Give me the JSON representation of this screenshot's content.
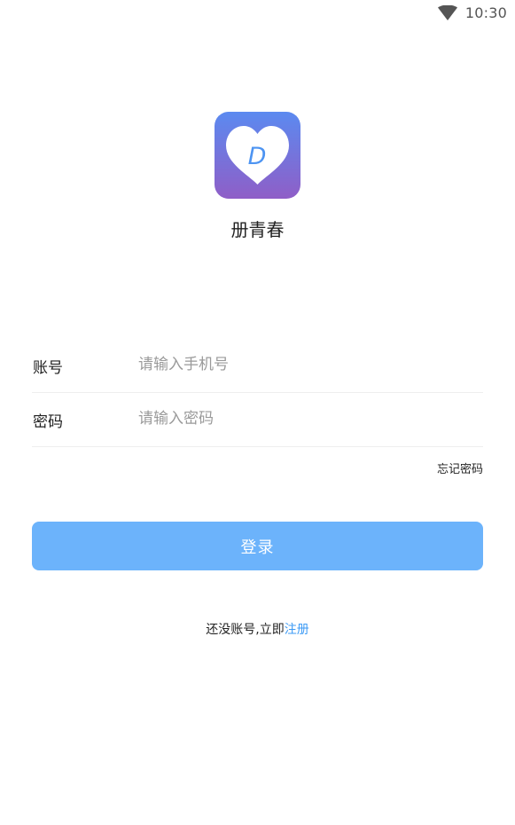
{
  "status_bar": {
    "time": "10:30",
    "wifi_icon": "wifi-icon"
  },
  "app": {
    "logo_icon": "heart-logo-icon",
    "logo_letter": "D",
    "name": "册青春",
    "colors": {
      "logo_gradient_top": "#5b8af0",
      "logo_gradient_bottom": "#8f5ec7",
      "logo_letter": "#4d94f2"
    }
  },
  "form": {
    "account": {
      "label": "账号",
      "value": "",
      "placeholder": "请输入手机号"
    },
    "password": {
      "label": "密码",
      "value": "",
      "placeholder": "请输入密码"
    },
    "forgot_password": "忘记密码",
    "login_button": "登录"
  },
  "register": {
    "prompt": "还没账号,立即",
    "link": "注册"
  },
  "colors": {
    "primary_button": "#6cb3fb",
    "link": "#3d9bf5",
    "divider": "#eeeeee"
  }
}
